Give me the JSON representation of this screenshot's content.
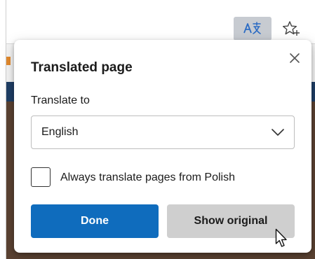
{
  "toolbar": {
    "translate_button_icon": "translate-icon",
    "favorite_button_icon": "star-add-icon"
  },
  "popup": {
    "title": "Translated page",
    "close_icon": "close-icon",
    "translate_to_label": "Translate to",
    "language_select": {
      "selected": "English",
      "icon": "chevron-down-icon"
    },
    "always_translate": {
      "label": "Always translate pages from Polish",
      "checked": false
    },
    "done_label": "Done",
    "show_original_label": "Show original"
  },
  "colors": {
    "accent": "#0f6cbd",
    "secondary_button": "#cfcfcf",
    "translate_button_active": "#c7cbd1"
  }
}
